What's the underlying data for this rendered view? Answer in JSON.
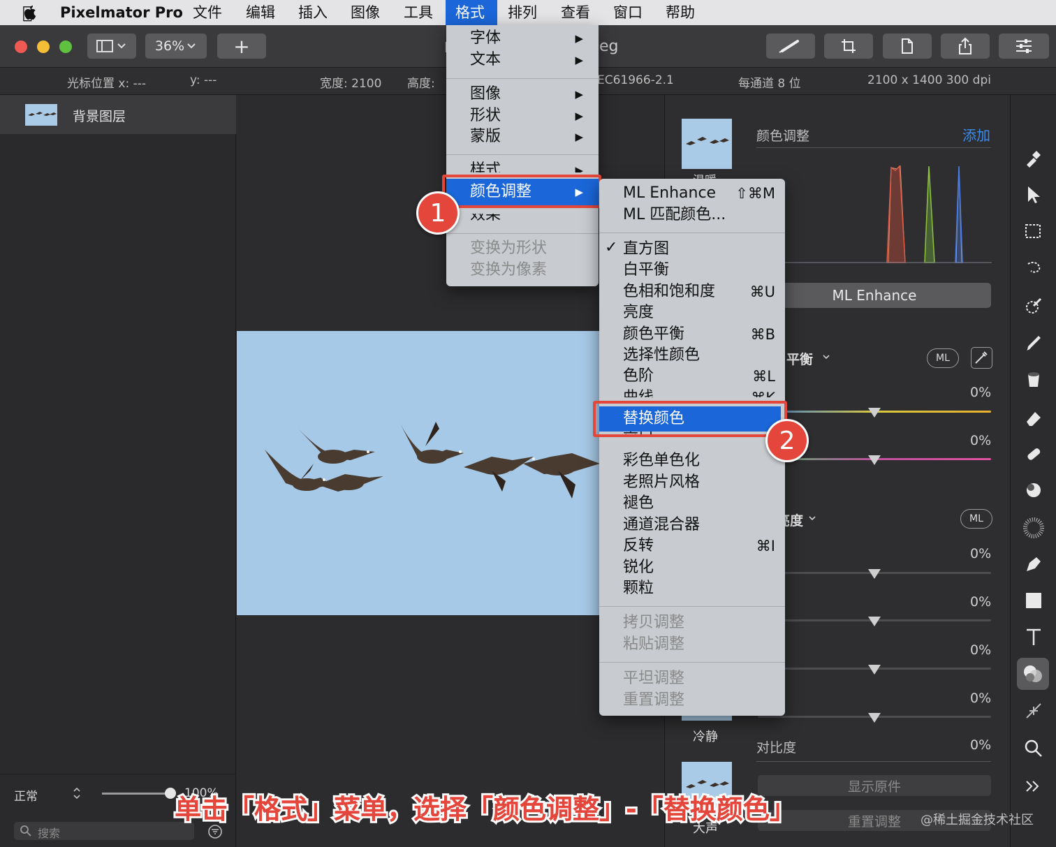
{
  "menubar": {
    "app_name": "Pixelmator Pro",
    "items": [
      "文件",
      "编辑",
      "插入",
      "图像",
      "工具",
      "格式",
      "排列",
      "查看",
      "窗口",
      "帮助"
    ]
  },
  "toolbar": {
    "zoom": "36%",
    "add_label": "+",
    "doc_title_fragment": "eg"
  },
  "infobar": {
    "cursor_x": "光标位置 x:  ---",
    "cursor_y": "y:  ---",
    "width": "宽度:  2100",
    "height": "高度:",
    "profile": "EC61966-2.1",
    "bits": "每通道 8 位",
    "dims": "2100 x 1400 300 dpi"
  },
  "layers": {
    "background_layer": "背景图层",
    "blend_mode": "正常",
    "opacity_partial": "100%",
    "search_placeholder": "搜索"
  },
  "format_menu": {
    "items": [
      "字体",
      "文本",
      "图像",
      "形状",
      "蒙版",
      "样式",
      "颜色调整",
      "效果",
      "变换为形状",
      "变换为像素"
    ]
  },
  "color_adjust_menu": {
    "ml_enhance": "ML Enhance",
    "ml_enhance_shortcut": "⇧⌘M",
    "ml_match": "ML 匹配颜色...",
    "histogram": "直方图",
    "white_balance": "白平衡",
    "hue_saturation": "色相和饱和度",
    "hue_saturation_shortcut": "⌘U",
    "brightness": "亮度",
    "color_balance": "颜色平衡",
    "color_balance_shortcut": "⌘B",
    "selective_color": "选择性颜色",
    "levels": "色阶",
    "levels_shortcut": "⌘L",
    "curves": "曲线",
    "curves_shortcut": "⌘K",
    "replace_color": "替换颜色",
    "black_white": "黑白",
    "colorize": "彩色单色化",
    "vintage": "老照片风格",
    "fade": "褪色",
    "channel_mixer": "通道混合器",
    "invert": "反转",
    "invert_shortcut": "⌘I",
    "sharpen": "锐化",
    "grain": "颗粒",
    "copy_adj": "拷贝调整",
    "paste_adj": "粘贴调整",
    "flatten_adj": "平坦调整",
    "reset_adj": "重置调整",
    "check": "✓"
  },
  "right_panel": {
    "title": "颜色调整",
    "add": "添加",
    "ml_enhance_btn": "ML Enhance",
    "white_balance_label": "白平衡",
    "ml_badge": "ML",
    "brightness_label": "亮度",
    "contrast_label": "对比度",
    "calm_preset": "冷静",
    "loud_preset": "大声",
    "preset_partial": "温暖",
    "pct": "0%",
    "show_original": "显示原件",
    "reset_adjust": "重置调整",
    "wb_temp": 0.5,
    "wb_tint": 0.5
  },
  "annotations": {
    "badge1": "1",
    "badge2": "2",
    "caption": "单击「格式」菜单，选择「颜色调整」-「替换颜色」",
    "watermark": "@稀土掘金技术社区"
  }
}
